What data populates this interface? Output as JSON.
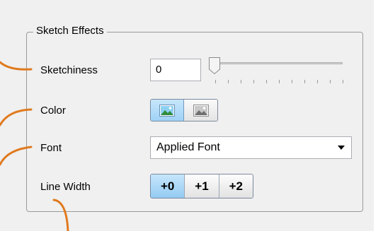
{
  "group": {
    "title": "Sketch Effects"
  },
  "rows": {
    "sketchiness": {
      "label": "Sketchiness",
      "value": "0",
      "slider_value": 0
    },
    "color": {
      "label": "Color",
      "options": [
        {
          "icon": "color-image-icon",
          "selected": true
        },
        {
          "icon": "grayscale-image-icon",
          "selected": false
        }
      ]
    },
    "font": {
      "label": "Font",
      "selected": "Applied Font"
    },
    "line_width": {
      "label": "Line Width",
      "options": [
        "+0",
        "+1",
        "+2"
      ],
      "selected_index": 0
    }
  },
  "colors": {
    "callout": "#e07a1f",
    "selected_fill": "#a9d7f7",
    "panel_bg": "#f0f0f0"
  }
}
